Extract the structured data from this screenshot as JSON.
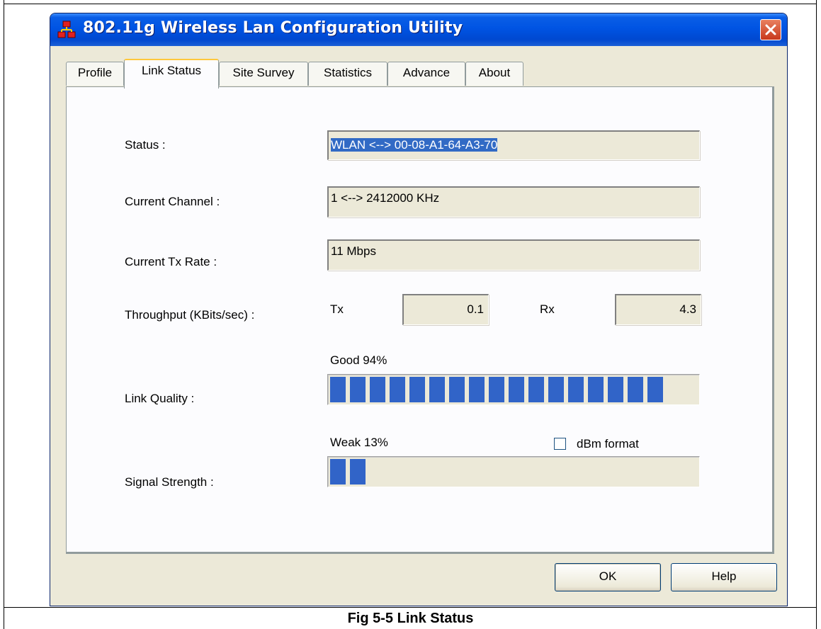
{
  "window": {
    "title": "802.11g Wireless Lan Configuration Utility"
  },
  "tabs": [
    {
      "label": "Profile"
    },
    {
      "label": "Link Status"
    },
    {
      "label": "Site Survey"
    },
    {
      "label": "Statistics"
    },
    {
      "label": "Advance"
    },
    {
      "label": "About"
    }
  ],
  "active_tab": "Link Status",
  "link_status": {
    "status_label": "Status :",
    "status_value": "WLAN <--> 00-08-A1-64-A3-70",
    "channel_label": "Current Channel :",
    "channel_value": "1 <--> 2412000 KHz",
    "tx_rate_label": "Current Tx Rate :",
    "tx_rate_value": "11 Mbps",
    "throughput_label": "Throughput (KBits/sec) :",
    "tx_label": "Tx",
    "tx_value": "0.1",
    "rx_label": "Rx",
    "rx_value": "4.3",
    "link_quality_label": "Link Quality :",
    "link_quality_text": "Good 94%",
    "link_quality_percent": 94,
    "signal_strength_label": "Signal Strength :",
    "signal_strength_text": "Weak 13%",
    "signal_strength_percent": 13,
    "dbm_format_label": "dBm format",
    "dbm_format_checked": false
  },
  "buttons": {
    "ok": "OK",
    "help": "Help"
  },
  "caption": "Fig 5-5 Link Status",
  "colors": {
    "titlebar": "#0054e3",
    "bar_segment": "#3164c8",
    "close_button": "#d8553a",
    "selection": "#316ac5"
  }
}
